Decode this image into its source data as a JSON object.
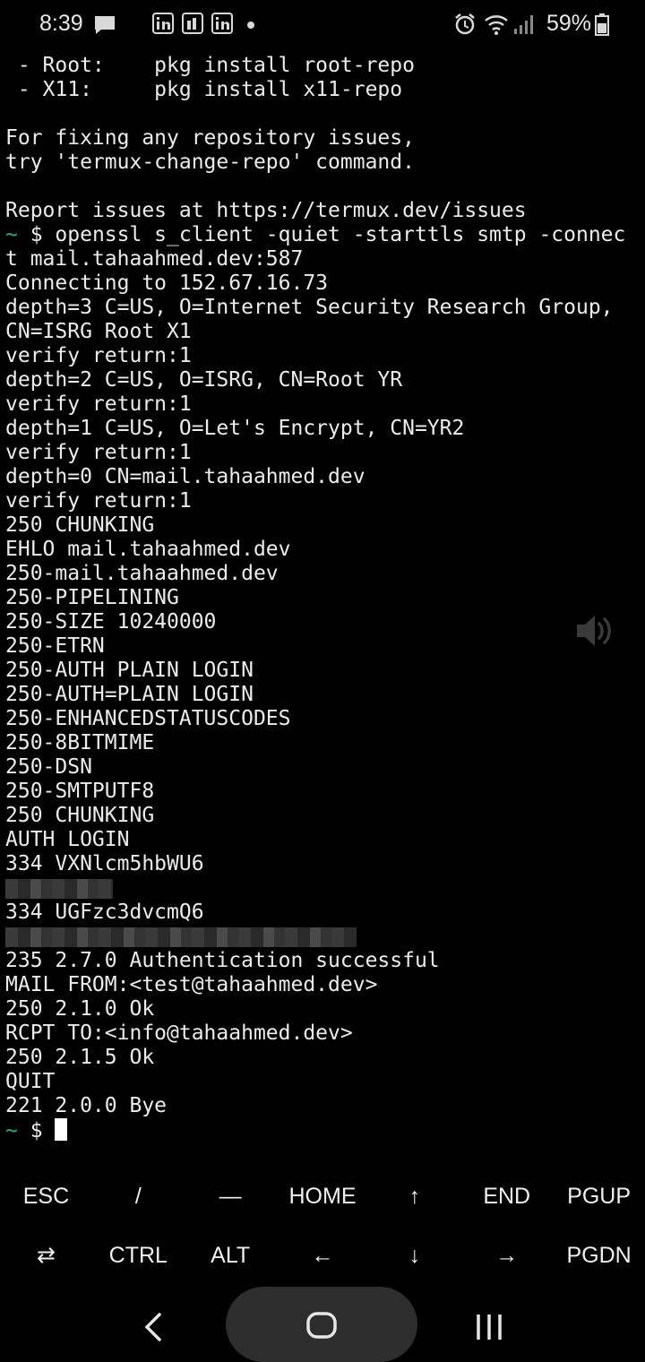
{
  "status_bar": {
    "time": "8:39",
    "battery": "59%"
  },
  "terminal": {
    "lines": [
      " - Root:    pkg install root-repo",
      " - X11:     pkg install x11-repo",
      "",
      "For fixing any repository issues,",
      "try 'termux-change-repo' command.",
      "",
      "Report issues at https://termux.dev/issues",
      {
        "prompt": "~",
        "text": " $ openssl s_client -quiet -starttls smtp -connec"
      },
      "t mail.tahaahmed.dev:587",
      "Connecting to 152.67.16.73",
      "depth=3 C=US, O=Internet Security Research Group,",
      "CN=ISRG Root X1",
      "verify return:1",
      "depth=2 C=US, O=ISRG, CN=Root YR",
      "verify return:1",
      "depth=1 C=US, O=Let's Encrypt, CN=YR2",
      "verify return:1",
      "depth=0 CN=mail.tahaahmed.dev",
      "verify return:1",
      "250 CHUNKING",
      "EHLO mail.tahaahmed.dev",
      "250-mail.tahaahmed.dev",
      "250-PIPELINING",
      "250-SIZE 10240000",
      "250-ETRN",
      "250-AUTH PLAIN LOGIN",
      "250-AUTH=PLAIN LOGIN",
      "250-ENHANCEDSTATUSCODES",
      "250-8BITMIME",
      "250-DSN",
      "250-SMTPUTF8",
      "250 CHUNKING",
      "AUTH LOGIN",
      "334 VXNlcm5hbWU6",
      {
        "redacted": 120
      },
      "334 UGFzc3dvcmQ6",
      {
        "redacted": 392
      },
      "235 2.7.0 Authentication successful",
      "MAIL FROM:<test@tahaahmed.dev>",
      "250 2.1.0 Ok",
      "RCPT TO:<info@tahaahmed.dev>",
      "250 2.1.5 Ok",
      "QUIT",
      "221 2.0.0 Bye",
      {
        "prompt": "~",
        "text": " $ ",
        "cursor": true
      }
    ]
  },
  "extra_keys": {
    "row1": [
      {
        "label": "ESC",
        "name": "esc-key"
      },
      {
        "label": "/",
        "name": "slash-key"
      },
      {
        "label": "—",
        "name": "dash-key"
      },
      {
        "label": "HOME",
        "name": "home-key"
      },
      {
        "label": "↑",
        "name": "up-arrow-key"
      },
      {
        "label": "END",
        "name": "end-key"
      },
      {
        "label": "PGUP",
        "name": "pgup-key"
      }
    ],
    "row2": [
      {
        "label": "⇄",
        "name": "tab-key"
      },
      {
        "label": "CTRL",
        "name": "ctrl-key"
      },
      {
        "label": "ALT",
        "name": "alt-key"
      },
      {
        "label": "←",
        "name": "left-arrow-key"
      },
      {
        "label": "↓",
        "name": "down-arrow-key"
      },
      {
        "label": "→",
        "name": "right-arrow-key"
      },
      {
        "label": "PGDN",
        "name": "pgdn-key"
      }
    ]
  },
  "icons": {
    "status_left": [
      "message-icon",
      "linkedin-icon",
      "linkedin-icon",
      "linkedin-icon",
      "dot-icon"
    ],
    "status_right": [
      "alarm-icon",
      "wifi-icon",
      "signal-icon",
      "battery-icon"
    ],
    "overlay": "volume-icon",
    "nav": [
      "back-icon",
      "home-icon",
      "recents-icon"
    ]
  },
  "colors": {
    "background": "#000000",
    "prompt": "#2ab27b",
    "text": "#ececec"
  }
}
